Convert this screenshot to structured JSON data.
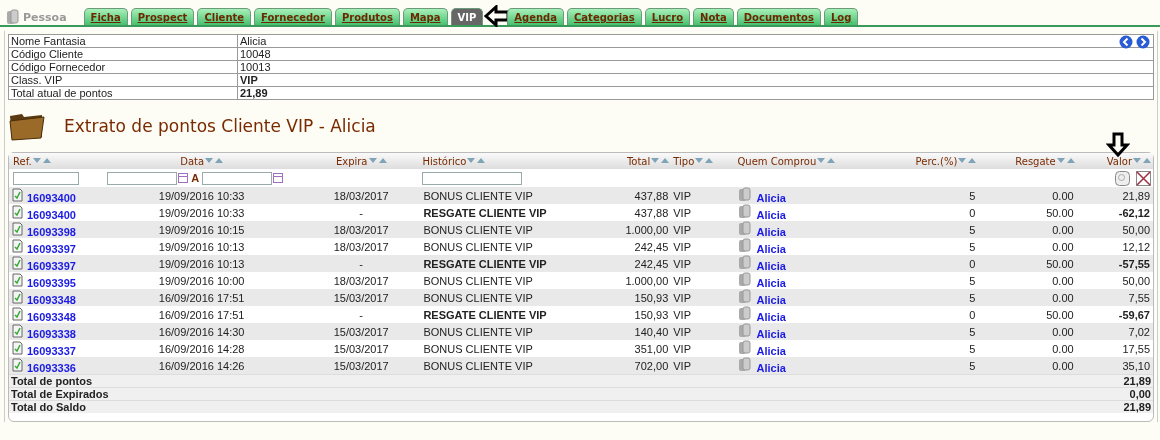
{
  "header": {
    "title": "Pessoa"
  },
  "tabs": [
    {
      "label": "Ficha",
      "selected": false
    },
    {
      "label": "Prospect",
      "selected": false
    },
    {
      "label": "Cliente",
      "selected": false
    },
    {
      "label": "Fornecedor",
      "selected": false
    },
    {
      "label": "Produtos",
      "selected": false
    },
    {
      "label": "Mapa",
      "selected": false
    },
    {
      "label": "VIP",
      "selected": true
    },
    {
      "label": "Agenda",
      "selected": false
    },
    {
      "label": "Categorias",
      "selected": false
    },
    {
      "label": "Lucro",
      "selected": false
    },
    {
      "label": "Nota",
      "selected": false
    },
    {
      "label": "Documentos",
      "selected": false
    },
    {
      "label": "Log",
      "selected": false
    }
  ],
  "info": [
    {
      "label": "Nome Fantasia",
      "value": "Alicia",
      "bold": false
    },
    {
      "label": "Código Cliente",
      "value": "10048",
      "bold": false
    },
    {
      "label": "Código Fornecedor",
      "value": "10013",
      "bold": false
    },
    {
      "label": "Class. VIP",
      "value": "VIP",
      "bold": true
    },
    {
      "label": "Total atual de pontos",
      "value": "21,89",
      "bold": true
    }
  ],
  "section": {
    "title": "Extrato de pontos Cliente VIP - Alicia"
  },
  "table": {
    "columns": [
      "Ref.",
      "Data",
      "Expira",
      "Histórico",
      "Total",
      "Tipo",
      "Quem Comprou",
      "Perc.(%)",
      "Resgate",
      "Valor"
    ],
    "date_separator": "A",
    "rows": [
      {
        "kind": "bonus",
        "ref": "16093400",
        "data": "19/09/2016 10:33",
        "expira": "18/03/2017",
        "historico": "BONUS CLIENTE VIP",
        "total": "437,88",
        "tipo": "VIP",
        "quem": "Alicia",
        "perc": "5",
        "resgate": "0.00",
        "valor": "21,89"
      },
      {
        "kind": "resgate",
        "ref": "16093400",
        "data": "19/09/2016 10:33",
        "expira": "-",
        "historico": "RESGATE CLIENTE VIP",
        "total": "437,88",
        "tipo": "VIP",
        "quem": "Alicia",
        "perc": "0",
        "resgate": "50.00",
        "valor": "-62,12"
      },
      {
        "kind": "bonus",
        "ref": "16093398",
        "data": "19/09/2016 10:15",
        "expira": "18/03/2017",
        "historico": "BONUS CLIENTE VIP",
        "total": "1.000,00",
        "tipo": "VIP",
        "quem": "Alicia",
        "perc": "5",
        "resgate": "0.00",
        "valor": "50,00"
      },
      {
        "kind": "bonus",
        "ref": "16093397",
        "data": "19/09/2016 10:13",
        "expira": "18/03/2017",
        "historico": "BONUS CLIENTE VIP",
        "total": "242,45",
        "tipo": "VIP",
        "quem": "Alicia",
        "perc": "5",
        "resgate": "0.00",
        "valor": "12,12"
      },
      {
        "kind": "resgate",
        "ref": "16093397",
        "data": "19/09/2016 10:13",
        "expira": "-",
        "historico": "RESGATE CLIENTE VIP",
        "total": "242,45",
        "tipo": "VIP",
        "quem": "Alicia",
        "perc": "0",
        "resgate": "50.00",
        "valor": "-57,55"
      },
      {
        "kind": "bonus",
        "ref": "16093395",
        "data": "19/09/2016 10:00",
        "expira": "18/03/2017",
        "historico": "BONUS CLIENTE VIP",
        "total": "1.000,00",
        "tipo": "VIP",
        "quem": "Alicia",
        "perc": "5",
        "resgate": "0.00",
        "valor": "50,00"
      },
      {
        "kind": "bonus",
        "ref": "16093348",
        "data": "16/09/2016 17:51",
        "expira": "15/03/2017",
        "historico": "BONUS CLIENTE VIP",
        "total": "150,93",
        "tipo": "VIP",
        "quem": "Alicia",
        "perc": "5",
        "resgate": "0.00",
        "valor": "7,55"
      },
      {
        "kind": "resgate",
        "ref": "16093348",
        "data": "16/09/2016 17:51",
        "expira": "-",
        "historico": "RESGATE CLIENTE VIP",
        "total": "150,93",
        "tipo": "VIP",
        "quem": "Alicia",
        "perc": "0",
        "resgate": "50.00",
        "valor": "-59,67"
      },
      {
        "kind": "bonus",
        "ref": "16093338",
        "data": "16/09/2016 14:30",
        "expira": "15/03/2017",
        "historico": "BONUS CLIENTE VIP",
        "total": "140,40",
        "tipo": "VIP",
        "quem": "Alicia",
        "perc": "5",
        "resgate": "0.00",
        "valor": "7,02"
      },
      {
        "kind": "bonus",
        "ref": "16093337",
        "data": "16/09/2016 14:28",
        "expira": "15/03/2017",
        "historico": "BONUS CLIENTE VIP",
        "total": "351,00",
        "tipo": "VIP",
        "quem": "Alicia",
        "perc": "5",
        "resgate": "0.00",
        "valor": "17,55"
      },
      {
        "kind": "bonus",
        "ref": "16093336",
        "data": "16/09/2016 14:26",
        "expira": "15/03/2017",
        "historico": "BONUS CLIENTE VIP",
        "total": "702,00",
        "tipo": "VIP",
        "quem": "Alicia",
        "perc": "5",
        "resgate": "0.00",
        "valor": "35,10"
      }
    ],
    "totals": [
      {
        "label": "Total de pontos",
        "value": "21,89"
      },
      {
        "label": "Total de Expirados",
        "value": "0,00"
      },
      {
        "label": "Total do Saldo",
        "value": "21,89"
      }
    ]
  }
}
